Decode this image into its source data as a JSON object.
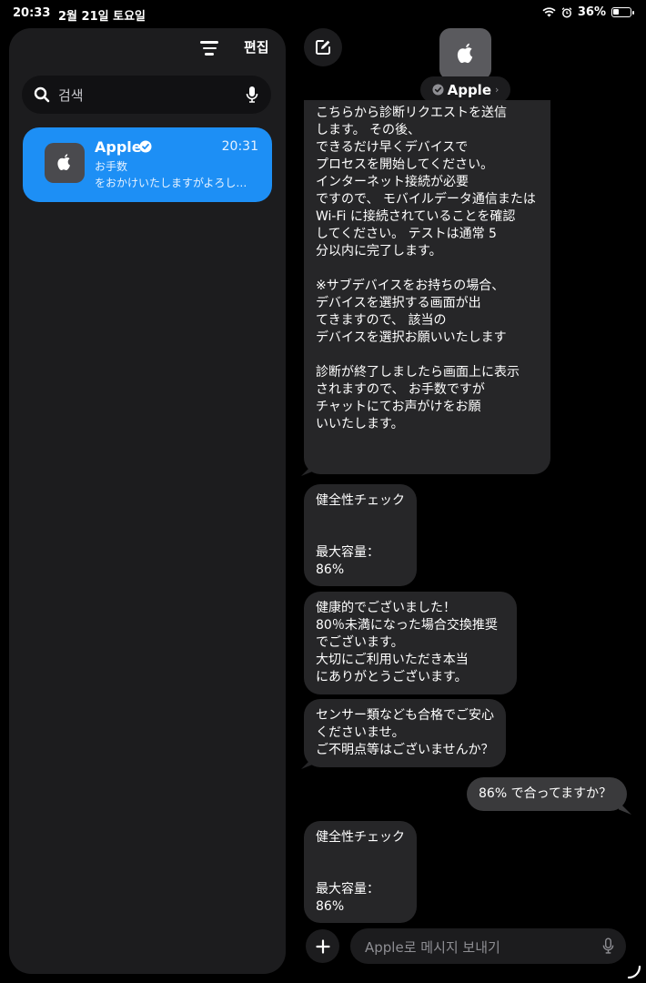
{
  "status_bar": {
    "time": "20:33",
    "date": "2월 21일 토요일",
    "battery_percent": "36%"
  },
  "sidebar": {
    "edit_label": "편집",
    "search_placeholder": "검색",
    "conversations": [
      {
        "name": "Apple",
        "time": "20:31",
        "line1": "お手数",
        "line2": "をおかけいたしますがよろし…",
        "verified": true,
        "selected": true
      }
    ]
  },
  "chat": {
    "contact_name": "Apple",
    "contact_chevron": "›",
    "messages": [
      {
        "id": "m1",
        "direction": "in",
        "text": "こちらから診断リクエストを送信\nします。 その後、\nできるだけ早くデバイスで\nプロセスを開始してください。\nインターネット接続が必要\nですので、 モバイルデータ通信または\nWi-Fi に接続されていることを確認\nしてください。 テストは通常 5\n分以内に完了します。\n\n※サブデバイスをお持ちの場合、\nデバイスを選択する画面が出\nてきますので、 該当の\nデバイスを選択お願いいたします\n\n診断が終了しましたら画面上に表示\nされますので、 お手数ですが\nチャットにてお声がけをお願\nいいたします。"
      },
      {
        "id": "m2",
        "direction": "in",
        "text": "健全性チェック\n\n\n最大容量：\n86%"
      },
      {
        "id": "m3",
        "direction": "in",
        "text": "健康的でございました！\n80％未満になった場合交換推奨\nでございます。\n大切にご利用いただき本当\nにありがとうございます。"
      },
      {
        "id": "m4",
        "direction": "in",
        "text": "センサー類なども合格でご安心\nくださいませ。\nご不明点等はございませんか？"
      },
      {
        "id": "m5",
        "direction": "out",
        "text": "86% で合ってますか？"
      },
      {
        "id": "m6",
        "direction": "in",
        "text": "健全性チェック\n\n\n最大容量：\n86%"
      }
    ],
    "message_placeholder": "Apple로 메시지 보내기"
  },
  "icons": {
    "filter": "filter-icon",
    "compose": "compose-icon",
    "search": "search-icon",
    "mic": "mic-icon",
    "apple_logo": "apple-logo-icon",
    "verified": "verified-badge-icon",
    "add": "plus-icon"
  },
  "colors": {
    "selected_conversation": "#1d8ff5",
    "incoming_bubble": "#262628",
    "outgoing_bubble": "#3a3a3c",
    "panel": "#1c1c1e"
  }
}
